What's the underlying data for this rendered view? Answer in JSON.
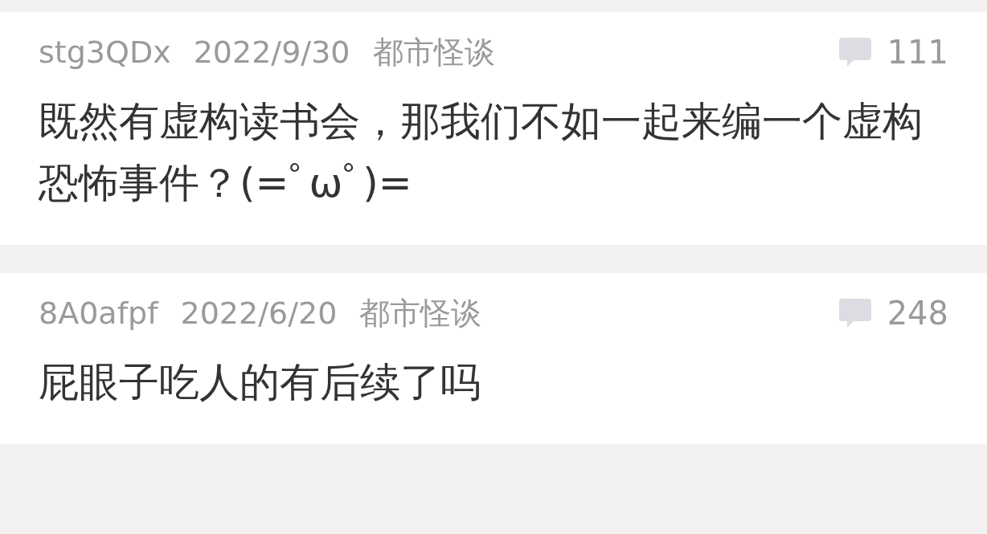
{
  "posts": [
    {
      "author": "stg3QDx",
      "date": "2022/9/30",
      "category": "都市怪谈",
      "comments": "111",
      "title": "既然有虚构读书会，那我们不如一起来编一个虚构恐怖事件？(=ﾟωﾟ)="
    },
    {
      "author": "8A0afpf",
      "date": "2022/6/20",
      "category": "都市怪谈",
      "comments": "248",
      "title": "屁眼子吃人的有后续了吗"
    }
  ]
}
